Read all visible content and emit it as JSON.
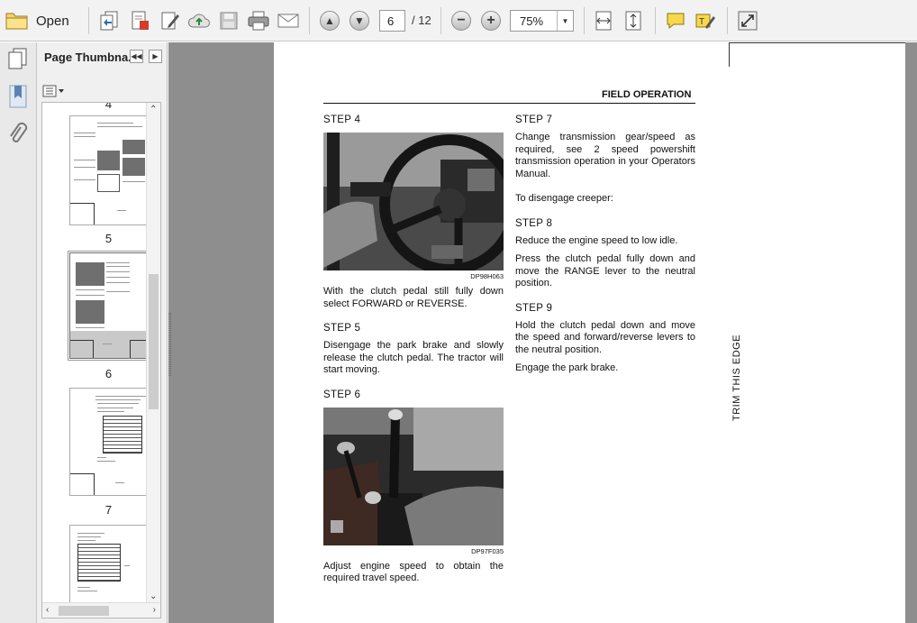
{
  "toolbar": {
    "open_label": "Open",
    "page_current": "6",
    "page_total": "/ 12",
    "zoom": "75%"
  },
  "sidebar": {
    "title": "Page Thumbna...",
    "thumbnails": [
      {
        "label": "4"
      },
      {
        "label": "5"
      },
      {
        "label": "6"
      },
      {
        "label": "7"
      }
    ]
  },
  "document": {
    "header": "FIELD OPERATION",
    "left_column": {
      "step4": "STEP 4",
      "photo1_caption": "DP98H063",
      "step4_text": "With the clutch pedal still fully down select FORWARD or REVERSE.",
      "step5": "STEP 5",
      "step5_text": "Disengage the park brake and slowly release the clutch pedal. The tractor will start moving.",
      "step6": "STEP 6",
      "photo2_caption": "DP97F035",
      "step6_text": "Adjust engine speed to obtain the required travel speed."
    },
    "right_column": {
      "step7": "STEP 7",
      "step7_text": "Change transmission gear/speed as required, see 2 speed powershift transmission operation in your Operators Manual.",
      "creeper_text": "To disengage creeper:",
      "step8": "STEP 8",
      "step8_text1": "Reduce the engine speed to low idle.",
      "step8_text2": "Press the clutch pedal fully down and move the RANGE lever to the neutral position.",
      "step9": "STEP 9",
      "step9_text1": "Hold the clutch pedal down and move the speed and forward/reverse levers to the neutral position.",
      "step9_text2": "Engage the park brake."
    },
    "trim_label": "TRIM THIS EDGE"
  }
}
